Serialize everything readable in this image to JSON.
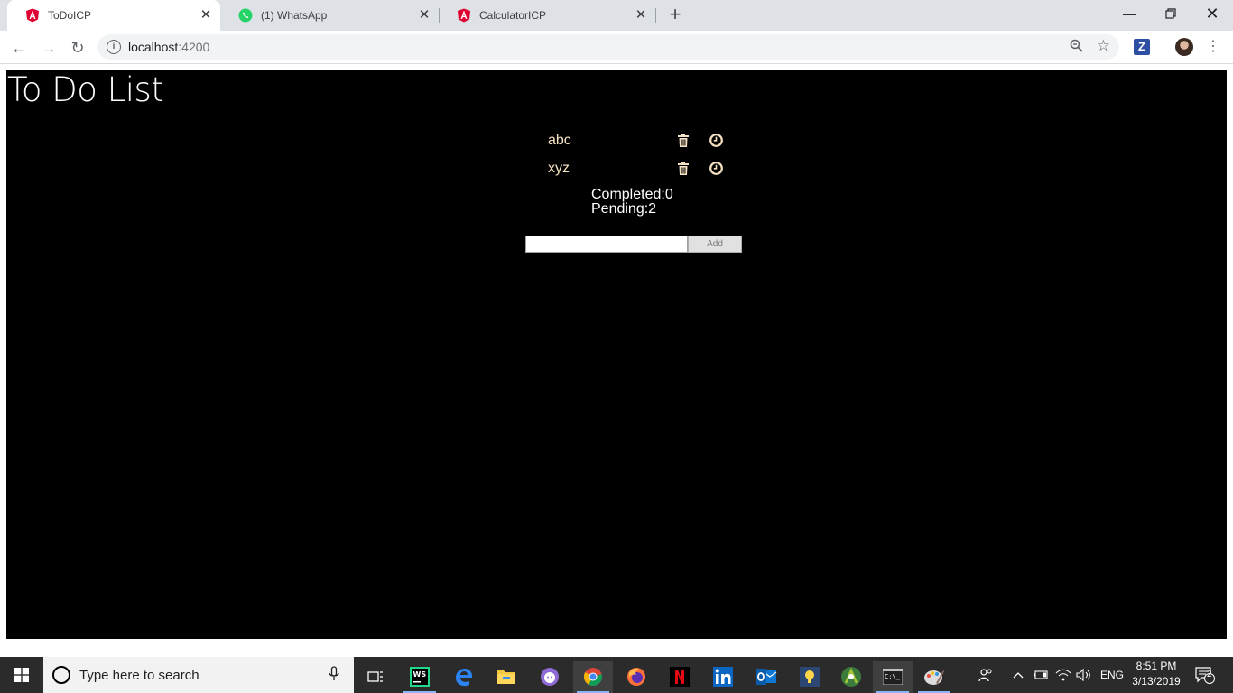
{
  "browser": {
    "tabs": [
      {
        "title": "ToDoICP",
        "active": true,
        "favicon": "angular-icon"
      },
      {
        "title": "(1) WhatsApp",
        "active": false,
        "favicon": "whatsapp-icon"
      },
      {
        "title": "CalculatorICP",
        "active": false,
        "favicon": "angular-icon"
      }
    ],
    "url_host": "localhost",
    "url_port": ":4200"
  },
  "app": {
    "title": "To Do List",
    "todos": [
      {
        "text": "abc"
      },
      {
        "text": "xyz"
      }
    ],
    "completed_label": "Completed:0",
    "pending_label": "Pending:2",
    "input_value": "",
    "add_label": "Add"
  },
  "taskbar": {
    "search_placeholder": "Type here to search",
    "language": "ENG",
    "time": "8:51 PM",
    "date": "3/13/2019",
    "notification_count": "2"
  },
  "colors": {
    "app_background": "#000000",
    "todo_text": "#f7e3c4",
    "angular_red": "#dd0031",
    "whatsapp_green": "#25d366"
  }
}
